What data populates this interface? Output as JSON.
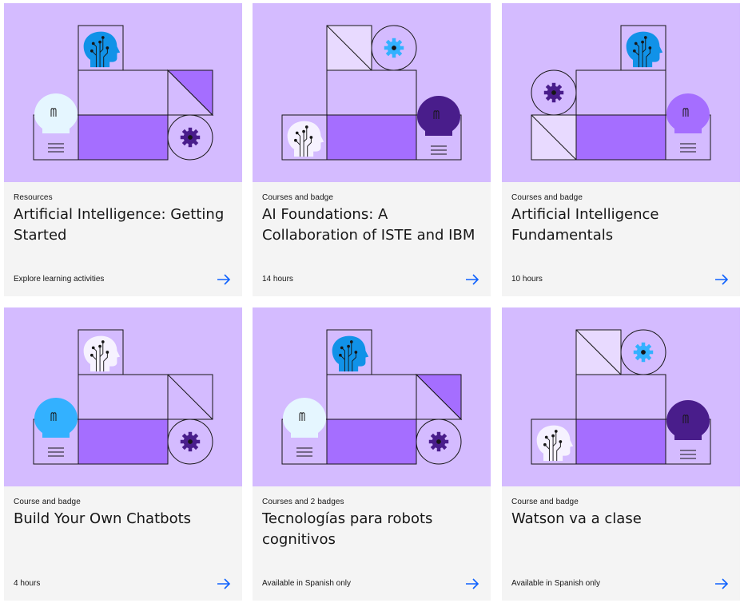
{
  "cards": [
    {
      "category": "Resources",
      "title": "Artificial Intelligence: Getting Started",
      "footer": "Explore learning activities",
      "arrow_icon": "arrow-right-icon"
    },
    {
      "category": "Courses and badge",
      "title": "AI Foundations: A Collaboration of ISTE and IBM",
      "footer": "14 hours",
      "arrow_icon": "arrow-right-icon"
    },
    {
      "category": "Courses and badge",
      "title": "Artificial Intelligence Fundamentals",
      "footer": "10 hours",
      "arrow_icon": "arrow-right-icon"
    },
    {
      "category": "Course and badge",
      "title": "Build Your Own Chatbots",
      "footer": "4 hours",
      "arrow_icon": "arrow-right-icon"
    },
    {
      "category": "Courses and 2 badges",
      "title": "Tecnologías para robots cognitivos",
      "footer": "Available in Spanish only",
      "arrow_icon": "arrow-right-icon"
    },
    {
      "category": "Course and badge",
      "title": "Watson va a clase",
      "footer": "Available in Spanish only",
      "arrow_icon": "arrow-right-icon"
    }
  ],
  "colors": {
    "art_background": "#d4bbff",
    "card_background": "#f4f4f4",
    "arrow": "#0f62fe",
    "purple_dark": "#491d8b",
    "purple_mid": "#a56eff",
    "purple_light": "#e8daff",
    "blue": "#1192e8",
    "cyan": "#33b1ff"
  }
}
